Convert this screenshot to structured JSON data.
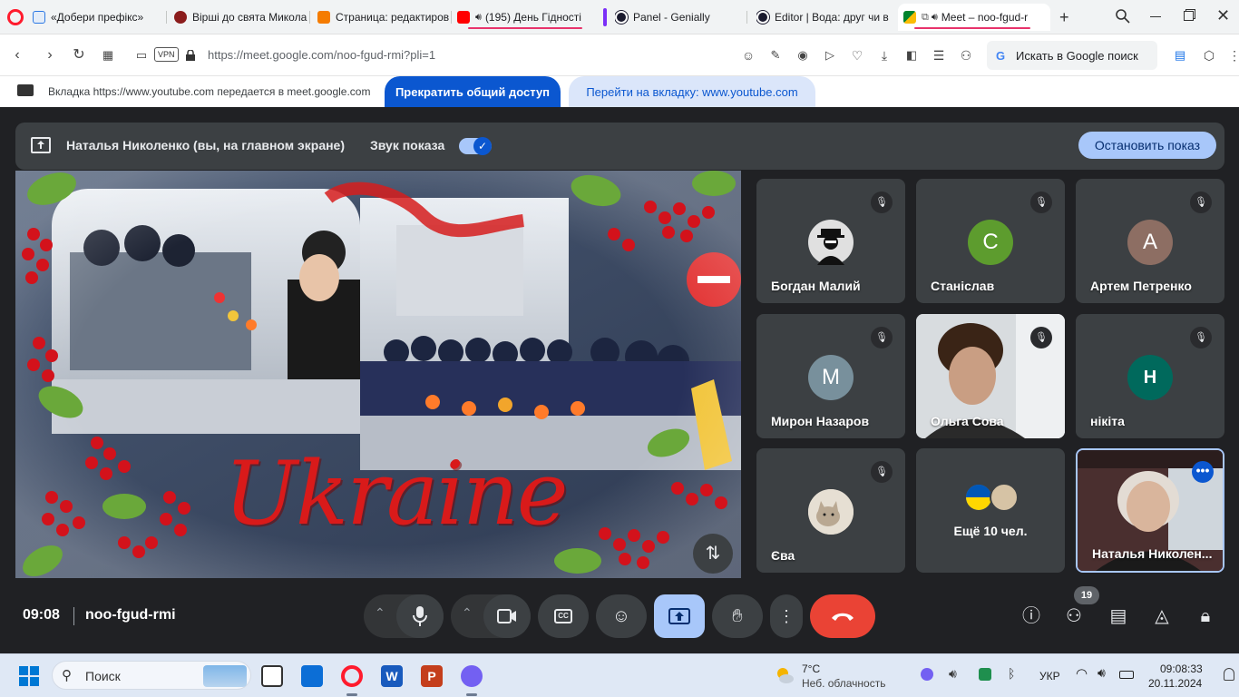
{
  "browser": {
    "tabs": [
      {
        "title": "«Добери префікс»",
        "favicon_color": "#2b78e4"
      },
      {
        "title": "Вірші до свята Микола",
        "favicon_color": "#8b1c1c"
      },
      {
        "title": "Страница: редактиров",
        "favicon_color": "#f57c00"
      },
      {
        "title": "(195) День Гідності",
        "favicon_color": "#ff0000"
      },
      {
        "title": "Panel - Genially",
        "favicon_color": "#1a1a2e"
      },
      {
        "title": "Editor | Вода: друг чи в",
        "favicon_color": "#1a1a2e"
      },
      {
        "title": "Meet – noo-fgud-r",
        "favicon_color": "#00832d",
        "active": true
      }
    ],
    "new_tab": "+",
    "url_host": "https://meet.google.com",
    "url_path": "/noo-fgud-rmi?pli=1",
    "vpn_label": "VPN",
    "search_placeholder": "Искать в Google поиск"
  },
  "share_banner": {
    "info": "Вкладка https://www.youtube.com передается в meet.google.com",
    "stop_label": "Прекратить общий доступ",
    "goto_label": "Перейти на вкладку: www.youtube.com"
  },
  "presenting": {
    "label": "Наталья Николенко (вы, на главном экране)",
    "audio_label": "Звук показа",
    "stop_label": "Остановить показ"
  },
  "stage": {
    "overlay_text": "Ukraine"
  },
  "participants": [
    {
      "name": "Богдан Малий",
      "avatar": "",
      "muted": true,
      "avatar_type": "photo-dark"
    },
    {
      "name": "Станіслав",
      "avatar": "С",
      "muted": true,
      "color": "#5d9c2e"
    },
    {
      "name": "Артем Петренко",
      "avatar": "А",
      "muted": true,
      "color": "#8d6e63"
    },
    {
      "name": "Мирон Назаров",
      "avatar": "М",
      "muted": true,
      "color": "#78909c"
    },
    {
      "name": "Ольга Сова",
      "avatar": "",
      "muted": true,
      "avatar_type": "video"
    },
    {
      "name": "нікіта",
      "avatar": "Н",
      "muted": true,
      "color": "#00695c"
    },
    {
      "name": "Єва",
      "avatar": "",
      "muted": true,
      "avatar_type": "photo-cat"
    },
    {
      "name": "Ещё 10 чел.",
      "avatar": "",
      "muted": false,
      "avatar_type": "more"
    },
    {
      "name": "Наталья Николен...",
      "avatar": "",
      "muted": false,
      "avatar_type": "self-video"
    }
  ],
  "bottom": {
    "time": "09:08",
    "meeting_code": "noo-fgud-rmi",
    "people_count": "19"
  },
  "taskbar": {
    "search_label": "Поиск",
    "weather_temp": "7°C",
    "weather_desc": "Неб. облачность",
    "language": "УКР",
    "clock_time": "09:08:33",
    "clock_date": "20.11.2024"
  }
}
